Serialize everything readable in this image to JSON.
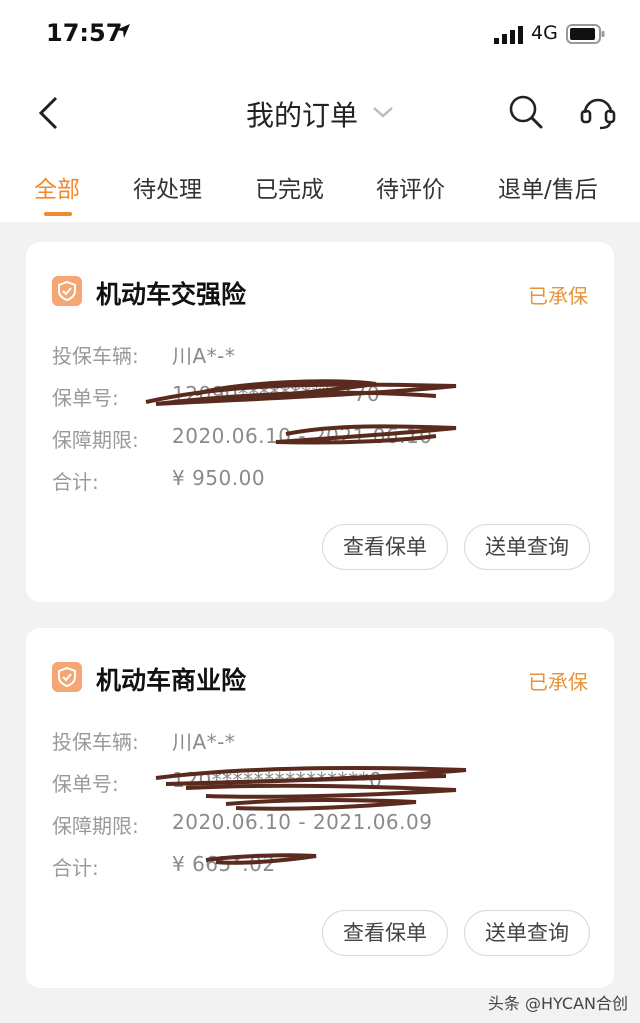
{
  "status_bar": {
    "time": "17:57",
    "network": "4G"
  },
  "header": {
    "title": "我的订单"
  },
  "tabs": [
    "全部",
    "待处理",
    "已完成",
    "待评价",
    "退单/售后"
  ],
  "orders": [
    {
      "title": "机动车交强险",
      "status": "已承保",
      "rows": [
        {
          "label": "投保车辆:",
          "value": "川A*-*"
        },
        {
          "label": "保单号:",
          "value": "12090***********70"
        },
        {
          "label": "保障期限:",
          "value": "2020.06.10 - 2021.06.10"
        },
        {
          "label": "合计:",
          "value": "¥ 950.00"
        }
      ],
      "buttons": [
        "查看保单",
        "送单查询"
      ]
    },
    {
      "title": "机动车商业险",
      "status": "已承保",
      "rows": [
        {
          "label": "投保车辆:",
          "value": "川A*-*"
        },
        {
          "label": "保单号:",
          "value": "120***************0"
        },
        {
          "label": "保障期限:",
          "value": "2020.06.10 - 2021.06.09"
        },
        {
          "label": "合计:",
          "value": "¥ 665*.02"
        }
      ],
      "buttons": [
        "查看保单",
        "送单查询"
      ]
    }
  ],
  "watermark": "头条 @HYCAN合创",
  "colors": {
    "accent": "#f08a2c",
    "badge": "#f4a673",
    "scribble": "#5a2a1e"
  }
}
